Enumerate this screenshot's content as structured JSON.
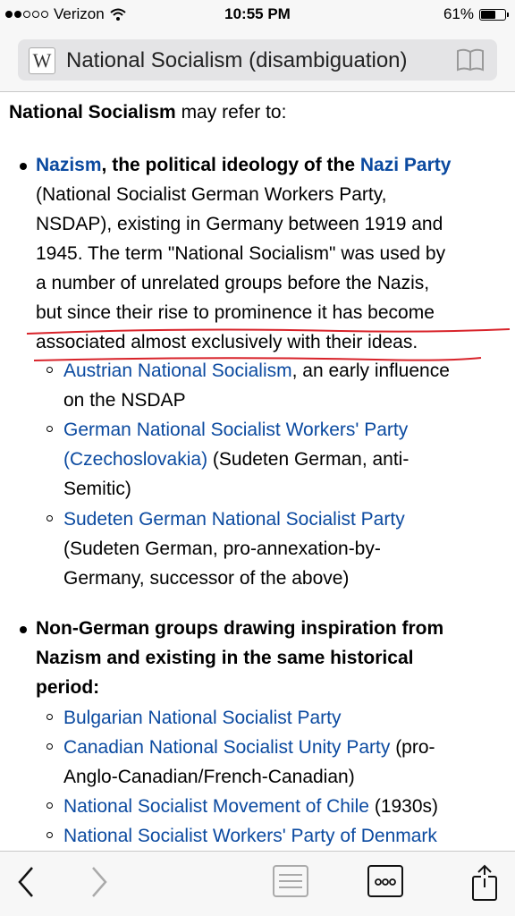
{
  "status": {
    "carrier": "Verizon",
    "time": "10:55 PM",
    "battery": "61%",
    "battery_level": 0.61
  },
  "urlbar": {
    "logo": "W",
    "title": "National Socialism (disambiguation)"
  },
  "intro": {
    "bold": "National Socialism",
    "rest": " may refer to:"
  },
  "item1": {
    "link1": "Nazism",
    "bold1": ", the political ideology of the ",
    "link2": "Nazi Party",
    "lines": [
      "(National Socialist German Workers Party,",
      "NSDAP), existing in Germany between 1919 and",
      "1945. The term \"National Socialism\" was used by",
      "a number of unrelated groups before the Nazis,",
      "but since their rise to prominence it has become",
      "associated almost exclusively with their ideas."
    ]
  },
  "sub1": [
    {
      "link": "Austrian National Socialism",
      "after": ", an early influence",
      "line2": "on the NSDAP"
    },
    {
      "link": "German National Socialist Workers' Party",
      "link2": "(Czechoslovakia)",
      "after": " (Sudeten German, anti-",
      "line3": "Semitic)"
    },
    {
      "link": "Sudeten German National Socialist Party",
      "line2": "(Sudeten German, pro-annexation-by-",
      "line3": "Germany, successor of the above)"
    }
  ],
  "item2": {
    "lines": [
      "Non-German groups drawing inspiration from",
      "Nazism and existing in the same historical",
      "period:"
    ]
  },
  "sub2": [
    {
      "link": "Bulgarian National Socialist Party"
    },
    {
      "link": "Canadian National Socialist Unity Party",
      "after": " (pro-",
      "line2": "Anglo-Canadian/French-Canadian)"
    },
    {
      "link": "National Socialist Movement of Chile",
      "after": " (1930s)"
    },
    {
      "link": "National Socialist Workers' Party of Denmark"
    }
  ]
}
